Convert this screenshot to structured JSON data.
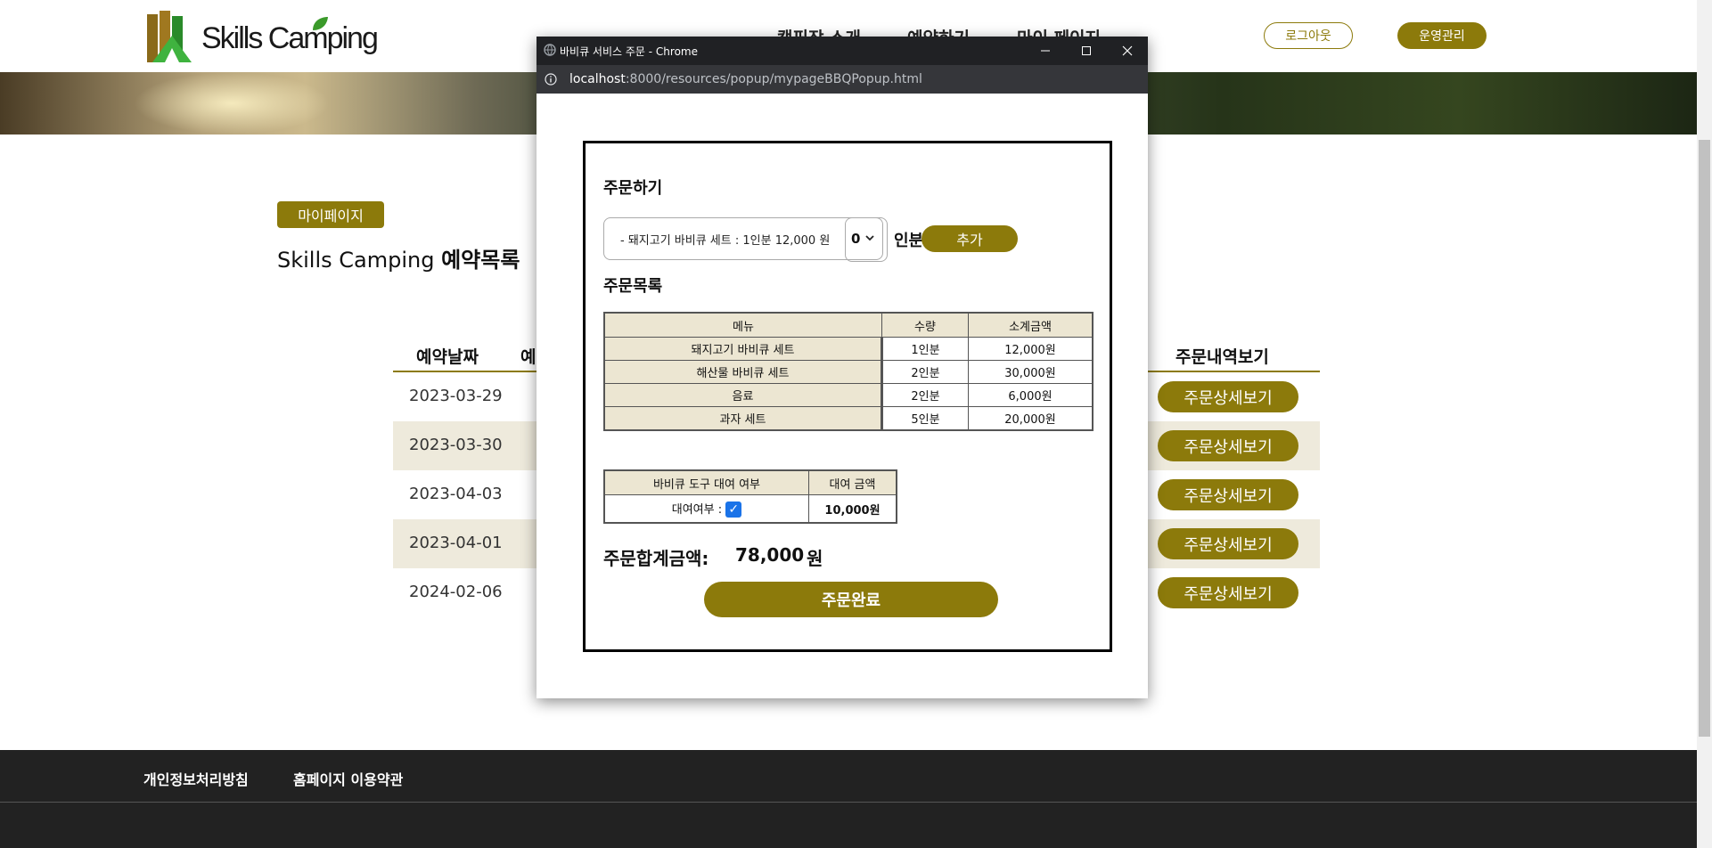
{
  "site": {
    "logo_text": "Skills Camping",
    "nav": [
      "캠핑장 소개",
      "예약하기",
      "마이 페이지"
    ],
    "logout_label": "로그아웃",
    "admin_label": "운영관리",
    "badge": "마이페이지",
    "title_plain": "Skills Camping ",
    "title_bold": "예약목록",
    "table_headers": {
      "date": "예약날짜",
      "col2": "예",
      "orders": "주문내역보기"
    },
    "reservations": [
      {
        "date": "2023-03-29",
        "button": "주문상세보기"
      },
      {
        "date": "2023-03-30",
        "button": "주문상세보기"
      },
      {
        "date": "2023-04-03",
        "button": "주문상세보기"
      },
      {
        "date": "2023-04-01",
        "button": "주문상세보기"
      },
      {
        "date": "2024-02-06",
        "button": "주문상세보기"
      }
    ],
    "footer_links": [
      "개인정보처리방침",
      "홈페이지 이용약관"
    ]
  },
  "popup": {
    "window_title": "바비큐 서비스 주문 - Chrome",
    "url_host": "localhost",
    "url_path": ":8000/resources/popup/mypageBBQPopup.html",
    "order_title": "주문하기",
    "menu_select_value": "- 돼지고기 바비큐 세트 : 1인분 12,000 원",
    "qty_value": "0",
    "qty_unit": "인분",
    "add_label": "추가",
    "order_list_title": "주문목록",
    "order_table": {
      "headers": [
        "메뉴",
        "수량",
        "소계금액"
      ],
      "rows": [
        {
          "menu": "돼지고기 바비큐 세트",
          "qty": "1인분",
          "subtotal": "12,000원"
        },
        {
          "menu": "해산물 바비큐 세트",
          "qty": "2인분",
          "subtotal": "30,000원"
        },
        {
          "menu": "음료",
          "qty": "2인분",
          "subtotal": "6,000원"
        },
        {
          "menu": "과자 세트",
          "qty": "5인분",
          "subtotal": "20,000원"
        }
      ]
    },
    "rental": {
      "headers": [
        "바비큐 도구 대여 여부",
        "대여 금액"
      ],
      "label": "대여여부 :",
      "checked": true,
      "amount": "10,000원"
    },
    "total_label": "주문합계금액:",
    "total_amount": "78,000",
    "total_unit": "원",
    "complete_label": "주문완료"
  },
  "colors": {
    "accent": "#8c7a0b",
    "row_alt": "#eeeadc",
    "table_head": "#ece6d2",
    "footer": "#222222"
  }
}
